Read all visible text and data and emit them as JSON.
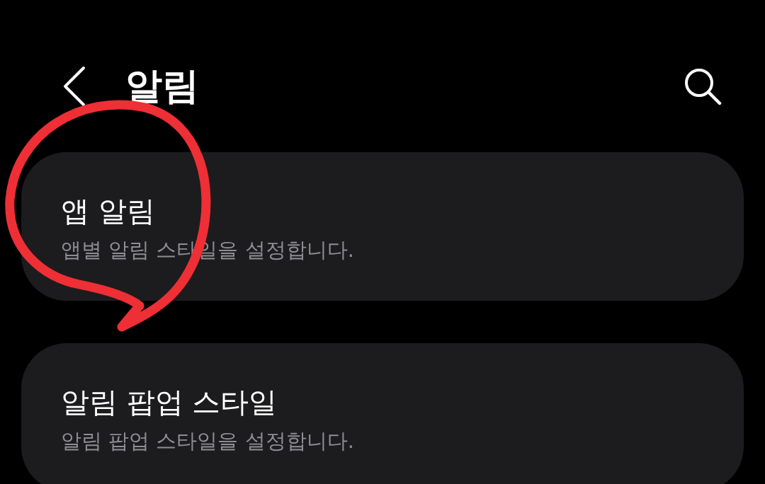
{
  "header": {
    "title": "알림"
  },
  "items": [
    {
      "title": "앱 알림",
      "subtitle": "앱별 알림 스타일을 설정합니다."
    },
    {
      "title": "알림 팝업 스타일",
      "subtitle": "알림 팝업 스타일을 설정합니다."
    }
  ],
  "annotation": {
    "kind": "freehand-circle",
    "color": "#ee2f35"
  }
}
